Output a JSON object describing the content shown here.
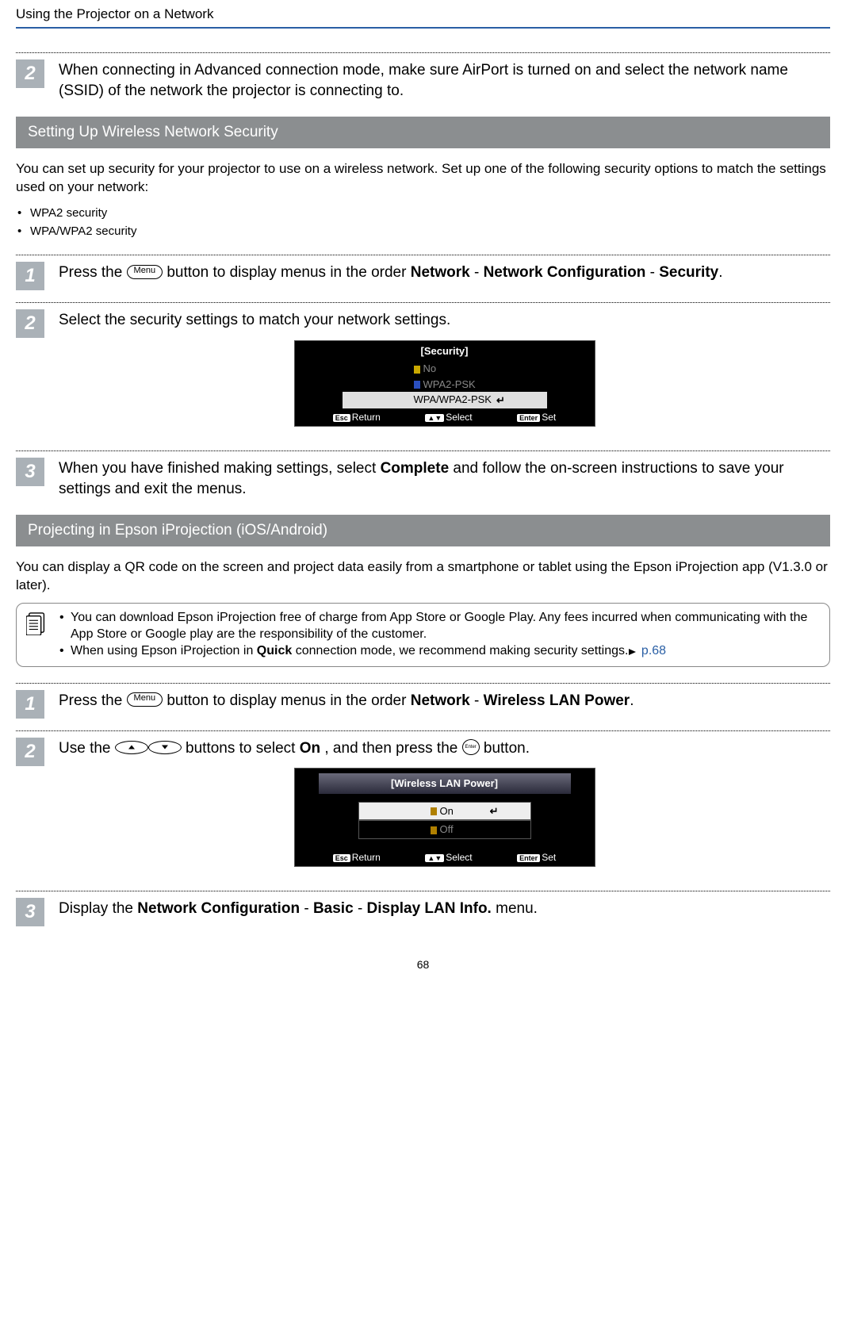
{
  "header": "Using the Projector on a Network",
  "page_number": "68",
  "top_step": {
    "num": "2",
    "text_parts": [
      "When connecting in Advanced connection mode, make sure AirPort is turned on and select the network name (SSID) of the network the projector is connecting to."
    ]
  },
  "section_security": {
    "title": "Setting Up Wireless Network Security",
    "intro": "You can set up security for your projector to use on a wireless network. Set up one of the following security options to match the settings used on your network:",
    "bullets": [
      "WPA2 security",
      "WPA/WPA2 security"
    ],
    "steps": {
      "s1": {
        "num": "1",
        "p1": "Press the ",
        "menu_label": "Menu",
        "p2": " button to display menus in the order ",
        "b1": "Network",
        "sep1": " - ",
        "b2": "Network Configuration",
        "sep2": " - ",
        "b3": "Security",
        "end": "."
      },
      "s2": {
        "num": "2",
        "text": "Select the security settings to match your network settings."
      },
      "s3": {
        "num": "3",
        "p1": "When you have finished making settings, select ",
        "b1": "Complete",
        "p2": " and follow the on-screen instructions to save your settings and exit the menus."
      }
    },
    "osd": {
      "title": "[Security]",
      "opt_no": "No",
      "opt_wpa2": "WPA2-PSK",
      "opt_sel": "WPA/WPA2-PSK",
      "return_indicator": "↵",
      "footer_return_key": "Esc",
      "footer_return": "Return",
      "footer_select_key": "▲▼",
      "footer_select": "Select",
      "footer_set_key": "Enter",
      "footer_set": "Set"
    }
  },
  "section_iproj": {
    "title": "Projecting in Epson iProjection (iOS/Android)",
    "intro": "You can display a QR code on the screen and project data easily from a smartphone or tablet using the Epson iProjection app (V1.3.0 or later).",
    "note": {
      "li1": "You can download Epson iProjection free of charge from App Store or Google Play. Any fees incurred when communicating with the App Store or Google play are the responsibility of the customer.",
      "li2_p1": "When using Epson iProjection in ",
      "li2_b1": "Quick",
      "li2_p2": " connection mode, we recommend making security settings.",
      "li2_link": " p.68"
    },
    "steps": {
      "s1": {
        "num": "1",
        "p1": "Press the ",
        "menu_label": "Menu",
        "p2": " button to display menus in the order ",
        "b1": "Network",
        "sep": " - ",
        "b2": "Wireless LAN Power",
        "end": "."
      },
      "s2": {
        "num": "2",
        "p1": "Use the ",
        "p2": " buttons to select ",
        "b1": "On",
        "p3": ", and then press the ",
        "enter_label": "Enter",
        "p4": " button."
      },
      "s3": {
        "num": "3",
        "p1": "Display the ",
        "b1": "Network Configuration",
        "sep1": " - ",
        "b2": "Basic",
        "sep2": " - ",
        "b3": "Display LAN Info.",
        "p2": " menu."
      }
    },
    "osd": {
      "title": "[Wireless LAN Power]",
      "on": "On",
      "off": "Off",
      "return_indicator": "↵",
      "footer_return_key": "Esc",
      "footer_return": "Return",
      "footer_select_key": "▲▼",
      "footer_select": "Select",
      "footer_set_key": "Enter",
      "footer_set": "Set"
    }
  }
}
